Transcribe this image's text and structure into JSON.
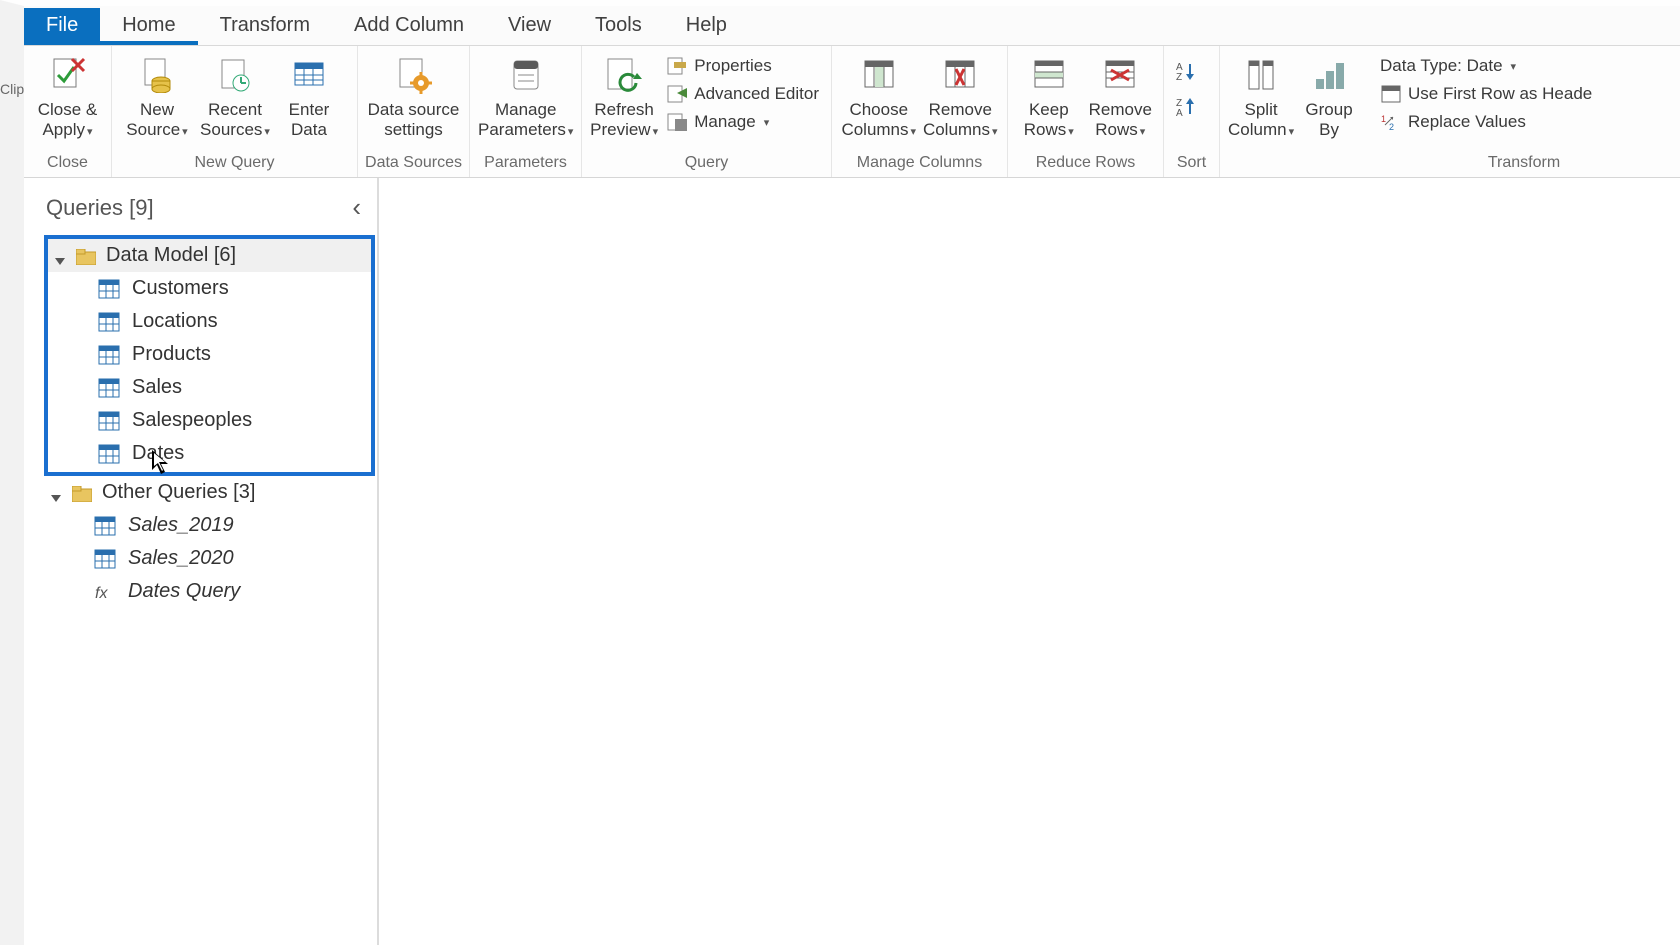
{
  "clip_label": "Clip",
  "tabs": {
    "file": "File",
    "home": "Home",
    "transform": "Transform",
    "add_column": "Add Column",
    "view": "View",
    "tools": "Tools",
    "help": "Help"
  },
  "ribbon": {
    "close_group": {
      "close_apply": "Close & Apply",
      "label": "Close"
    },
    "new_query": {
      "new_source": "New Source",
      "recent_sources": "Recent Sources",
      "enter_data": "Enter Data",
      "label": "New Query"
    },
    "data_sources": {
      "data_source_settings": "Data source settings",
      "label": "Data Sources"
    },
    "parameters": {
      "manage_parameters": "Manage Parameters",
      "label": "Parameters"
    },
    "query": {
      "refresh_preview": "Refresh Preview",
      "properties": "Properties",
      "advanced_editor": "Advanced Editor",
      "manage": "Manage",
      "label": "Query"
    },
    "manage_columns": {
      "choose_columns": "Choose Columns",
      "remove_columns": "Remove Columns",
      "label": "Manage Columns"
    },
    "reduce_rows": {
      "keep_rows": "Keep Rows",
      "remove_rows": "Remove Rows",
      "label": "Reduce Rows"
    },
    "sort": {
      "label": "Sort"
    },
    "transform": {
      "split_column": "Split Column",
      "group_by": "Group By",
      "data_type": "Data Type: Date",
      "first_row_headers": "Use First Row as Heade",
      "replace_values": "Replace Values",
      "label": "Transform"
    }
  },
  "queries_pane": {
    "title": "Queries [9]",
    "folders": {
      "data_model": {
        "label": "Data Model [6]",
        "items": {
          "customers": "Customers",
          "locations": "Locations",
          "products": "Products",
          "sales": "Sales",
          "salespeoples": "Salespeoples",
          "dates": "Dates"
        }
      },
      "other": {
        "label": "Other Queries [3]",
        "items": {
          "sales_2019": "Sales_2019",
          "sales_2020": "Sales_2020",
          "dates_query": "Dates Query"
        }
      }
    }
  }
}
